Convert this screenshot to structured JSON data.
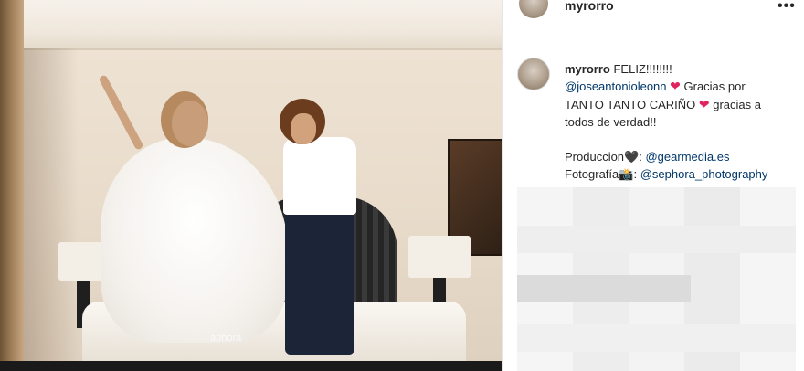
{
  "post": {
    "username": "myrorro",
    "more_label": "•••",
    "photo_watermark": "aphora"
  },
  "caption": {
    "username": "myrorro",
    "text_1": "FELIZ!!!!!!!!",
    "mention_1": "@joseantonioleonn",
    "heart_1": "❤",
    "text_2": "Gracias por",
    "text_3": "TANTO TANTO CARIÑO",
    "heart_2": "❤",
    "text_4": "gracias a",
    "text_5": "todos de verdad!!",
    "production_label": "Produccion",
    "production_emoji": "🖤",
    "production_sep": ":",
    "mention_2": "@gearmedia.es",
    "photo_label": "Fotografía",
    "photo_emoji": "📸",
    "photo_sep": ":",
    "mention_3": "@sephora_photography"
  },
  "colors": {
    "mention": "#00376b",
    "heart": "#e0245e",
    "text": "#262626"
  }
}
